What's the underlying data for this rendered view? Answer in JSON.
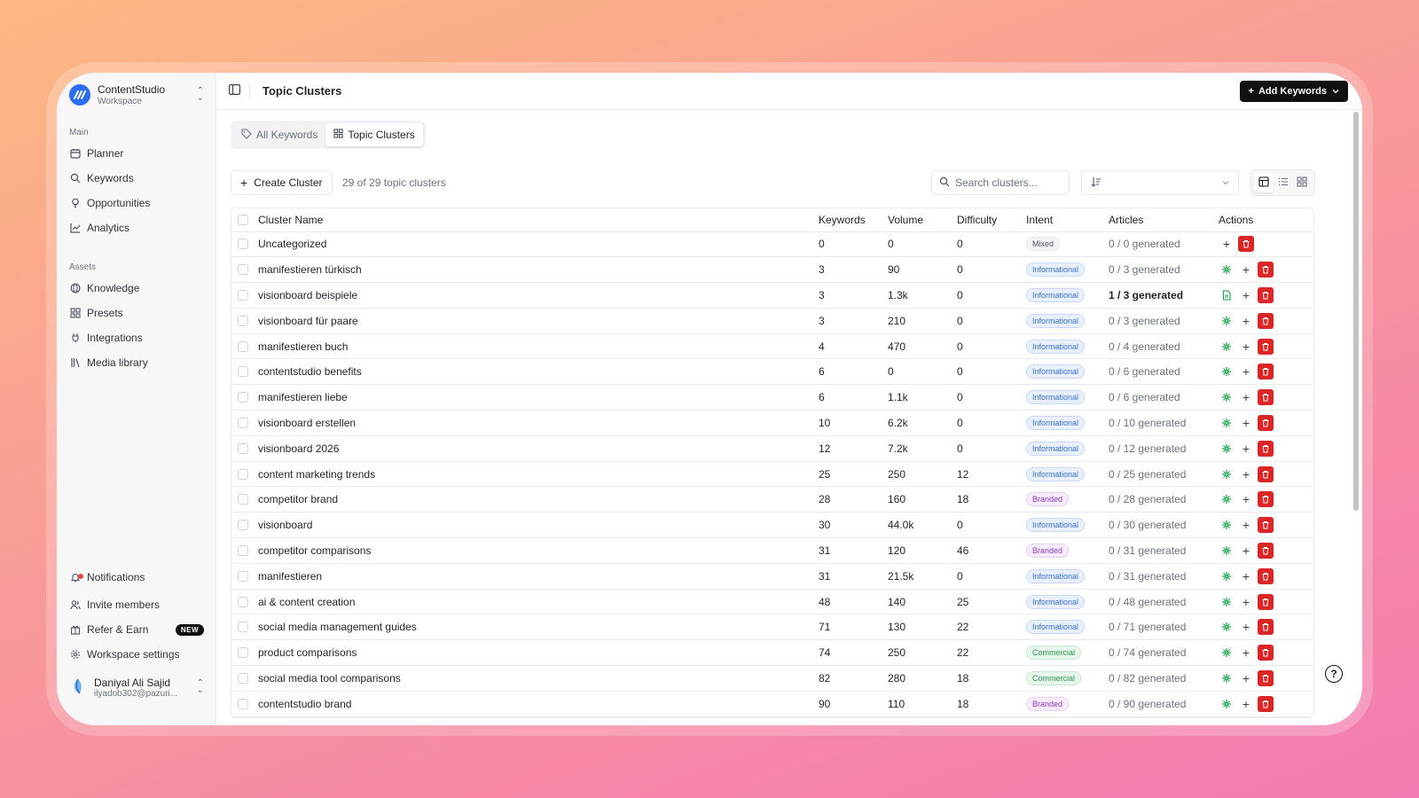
{
  "workspace": {
    "name": "ContentStudio",
    "sub": "Workspace",
    "logo": "m"
  },
  "sidebar": {
    "main_label": "Main",
    "main_items": [
      {
        "label": "Planner",
        "icon": "calendar-icon"
      },
      {
        "label": "Keywords",
        "icon": "search-icon"
      },
      {
        "label": "Opportunities",
        "icon": "lightbulb-icon"
      },
      {
        "label": "Analytics",
        "icon": "chart-icon"
      }
    ],
    "assets_label": "Assets",
    "asset_items": [
      {
        "label": "Knowledge",
        "icon": "globe-icon"
      },
      {
        "label": "Presets",
        "icon": "grid-icon"
      },
      {
        "label": "Integrations",
        "icon": "plug-icon"
      },
      {
        "label": "Media library",
        "icon": "library-icon"
      }
    ],
    "bottom": {
      "notifications": "Notifications",
      "invite": "Invite members",
      "refer": "Refer & Earn",
      "refer_badge": "NEW",
      "settings": "Workspace settings"
    },
    "user": {
      "name": "Daniyal Ali Sajid",
      "email": "ilyadob302@pazuri..."
    }
  },
  "header": {
    "title": "Topic Clusters",
    "add_keywords": "Add Keywords"
  },
  "tabs": [
    {
      "label": "All Keywords",
      "active": false
    },
    {
      "label": "Topic Clusters",
      "active": true
    }
  ],
  "toolbar": {
    "create_cluster": "Create Cluster",
    "count_text": "29 of 29 topic clusters",
    "search_placeholder": "Search clusters..."
  },
  "table": {
    "headers": {
      "name": "Cluster Name",
      "keywords": "Keywords",
      "volume": "Volume",
      "difficulty": "Difficulty",
      "intent": "Intent",
      "articles": "Articles",
      "actions": "Actions"
    },
    "rows": [
      {
        "name": "Uncategorized",
        "keywords": "0",
        "volume": "0",
        "difficulty": "0",
        "intent": "Mixed",
        "articles": "0 / 0 generated",
        "action": "none"
      },
      {
        "name": "manifestieren türkisch",
        "keywords": "3",
        "volume": "90",
        "difficulty": "0",
        "intent": "Informational",
        "articles": "0 / 3 generated",
        "action": "generate"
      },
      {
        "name": "visionboard beispiele",
        "keywords": "3",
        "volume": "1.3k",
        "difficulty": "0",
        "intent": "Informational",
        "articles": "1 / 3 generated",
        "action": "document"
      },
      {
        "name": "visionboard für paare",
        "keywords": "3",
        "volume": "210",
        "difficulty": "0",
        "intent": "Informational",
        "articles": "0 / 3 generated",
        "action": "generate"
      },
      {
        "name": "manifestieren buch",
        "keywords": "4",
        "volume": "470",
        "difficulty": "0",
        "intent": "Informational",
        "articles": "0 / 4 generated",
        "action": "generate"
      },
      {
        "name": "contentstudio benefits",
        "keywords": "6",
        "volume": "0",
        "difficulty": "0",
        "intent": "Informational",
        "articles": "0 / 6 generated",
        "action": "generate"
      },
      {
        "name": "manifestieren liebe",
        "keywords": "6",
        "volume": "1.1k",
        "difficulty": "0",
        "intent": "Informational",
        "articles": "0 / 6 generated",
        "action": "generate"
      },
      {
        "name": "visionboard erstellen",
        "keywords": "10",
        "volume": "6.2k",
        "difficulty": "0",
        "intent": "Informational",
        "articles": "0 / 10 generated",
        "action": "generate"
      },
      {
        "name": "visionboard 2026",
        "keywords": "12",
        "volume": "7.2k",
        "difficulty": "0",
        "intent": "Informational",
        "articles": "0 / 12 generated",
        "action": "generate"
      },
      {
        "name": "content marketing trends",
        "keywords": "25",
        "volume": "250",
        "difficulty": "12",
        "intent": "Informational",
        "articles": "0 / 25 generated",
        "action": "generate"
      },
      {
        "name": "competitor brand",
        "keywords": "28",
        "volume": "160",
        "difficulty": "18",
        "intent": "Branded",
        "articles": "0 / 28 generated",
        "action": "generate"
      },
      {
        "name": "visionboard",
        "keywords": "30",
        "volume": "44.0k",
        "difficulty": "0",
        "intent": "Informational",
        "articles": "0 / 30 generated",
        "action": "generate"
      },
      {
        "name": "competitor comparisons",
        "keywords": "31",
        "volume": "120",
        "difficulty": "46",
        "intent": "Branded",
        "articles": "0 / 31 generated",
        "action": "generate"
      },
      {
        "name": "manifestieren",
        "keywords": "31",
        "volume": "21.5k",
        "difficulty": "0",
        "intent": "Informational",
        "articles": "0 / 31 generated",
        "action": "generate"
      },
      {
        "name": "ai & content creation",
        "keywords": "48",
        "volume": "140",
        "difficulty": "25",
        "intent": "Informational",
        "articles": "0 / 48 generated",
        "action": "generate"
      },
      {
        "name": "social media management guides",
        "keywords": "71",
        "volume": "130",
        "difficulty": "22",
        "intent": "Informational",
        "articles": "0 / 71 generated",
        "action": "generate"
      },
      {
        "name": "product comparisons",
        "keywords": "74",
        "volume": "250",
        "difficulty": "22",
        "intent": "Commercial",
        "articles": "0 / 74 generated",
        "action": "generate"
      },
      {
        "name": "social media tool comparisons",
        "keywords": "82",
        "volume": "280",
        "difficulty": "18",
        "intent": "Commercial",
        "articles": "0 / 82 generated",
        "action": "generate"
      },
      {
        "name": "contentstudio brand",
        "keywords": "90",
        "volume": "110",
        "difficulty": "18",
        "intent": "Branded",
        "articles": "0 / 90 generated",
        "action": "generate"
      }
    ]
  },
  "help_label": "?"
}
